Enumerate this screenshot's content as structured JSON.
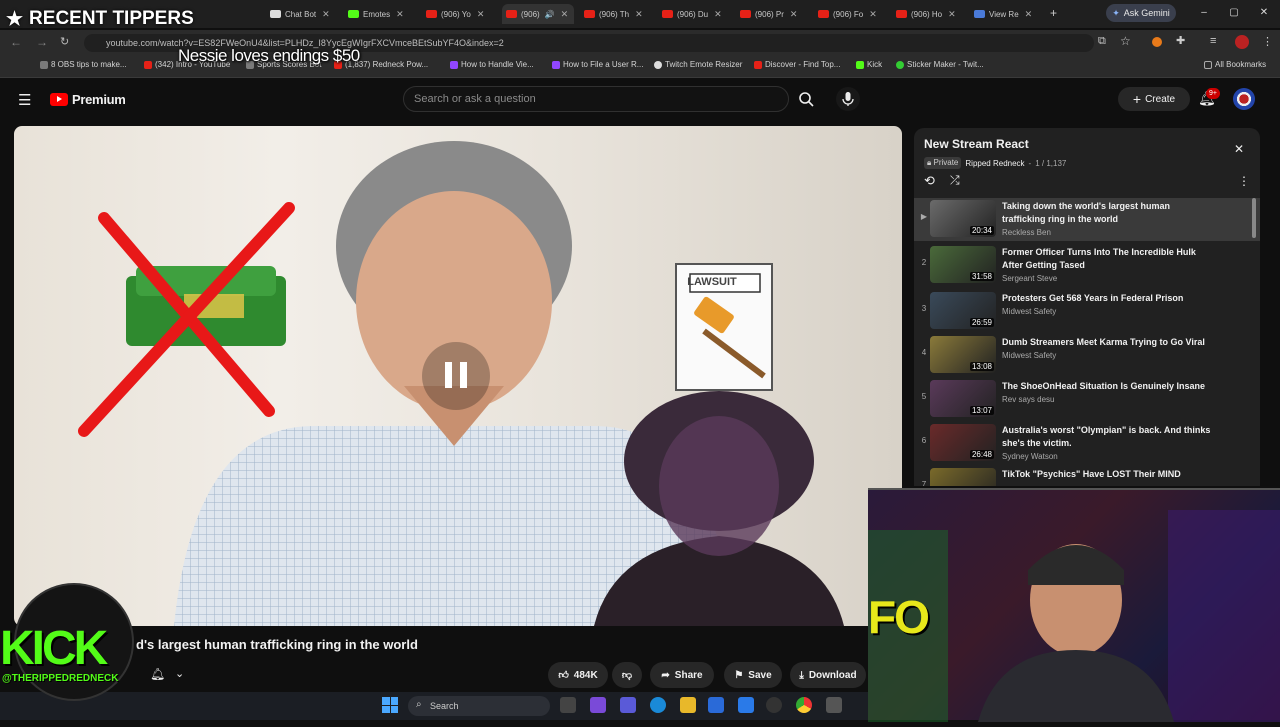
{
  "overlay": {
    "recent_tippers": "RECENT TIPPERS",
    "ticker": "Nessie loves endings $50",
    "kick_brand": "KICK",
    "kick_handle": "@THERIPPEDREDNECK"
  },
  "browser": {
    "tabs": [
      "Chat Bot",
      "Emotes",
      "(906) Yo",
      "(906)",
      "(906) Th",
      "(906) Du",
      "(906) Pr",
      "(906) Fo",
      "(906) Ho",
      "View Re"
    ],
    "ask_gemini": "Ask Gemini",
    "url": "youtube.com/watch?v=ES82FWeOnU4&list=PLHDz_I8YycEgWIgrFXCVmceBEtSubYF4O&index=2",
    "bookmarks": [
      "8 OBS tips to make...",
      "(342) Intro - YouTube",
      "Sports Scores Bot",
      "(1,837) Redneck Pow...",
      "How to Handle Vie...",
      "How to File a User R...",
      "Twitch Emote Resizer",
      "Discover - Find Top...",
      "Kick",
      "Sticker Maker - Twit..."
    ],
    "all_bookmarks": "All Bookmarks"
  },
  "youtube": {
    "logo_text": "Premium",
    "search_placeholder": "Search or ask a question",
    "create_label": "Create",
    "notification_count": "9+"
  },
  "video": {
    "lawsuit_label": "LAWSUIT",
    "title": "d's largest human trafficking ring in the world",
    "likes": "484K",
    "share_label": "Share",
    "save_label": "Save",
    "download_label": "Download"
  },
  "playlist": {
    "title": "New Stream React",
    "privacy": "Private",
    "owner": "Ripped Redneck",
    "position": "1 / 1,137",
    "items": [
      {
        "num": "▶",
        "title": "Taking down the world's largest human trafficking ring in the world",
        "channel": "Reckless Ben",
        "duration": "20:34",
        "thumb_color": "#6b6b6b"
      },
      {
        "num": "2",
        "title": "Former Officer Turns Into The Incredible Hulk After Getting Tased",
        "channel": "Sergeant Steve",
        "duration": "31:58",
        "thumb_color": "#4a6a3a"
      },
      {
        "num": "3",
        "title": "Protesters Get 568 Years in Federal Prison",
        "channel": "Midwest Safety",
        "duration": "26:59",
        "thumb_color": "#3a4a5a"
      },
      {
        "num": "4",
        "title": "Dumb Streamers Meet Karma Trying to Go Viral",
        "channel": "Midwest Safety",
        "duration": "13:08",
        "thumb_color": "#8a7a3a"
      },
      {
        "num": "5",
        "title": "The ShoeOnHead Situation Is Genuinely Insane",
        "channel": "Rev says desu",
        "duration": "13:07",
        "thumb_color": "#5a3a5a"
      },
      {
        "num": "6",
        "title": "Australia's worst \"Olympian\" is back. And thinks she's the victim.",
        "channel": "Sydney Watson",
        "duration": "26:48",
        "thumb_color": "#6a2a2a"
      },
      {
        "num": "7",
        "title": "TikTok \"Psychics\" Have LOST Their MIND",
        "channel": "",
        "duration": "",
        "thumb_color": "#7a6a2a"
      }
    ]
  },
  "taskbar": {
    "search_label": "Search"
  },
  "webcam": {
    "sign_text": "FO"
  }
}
